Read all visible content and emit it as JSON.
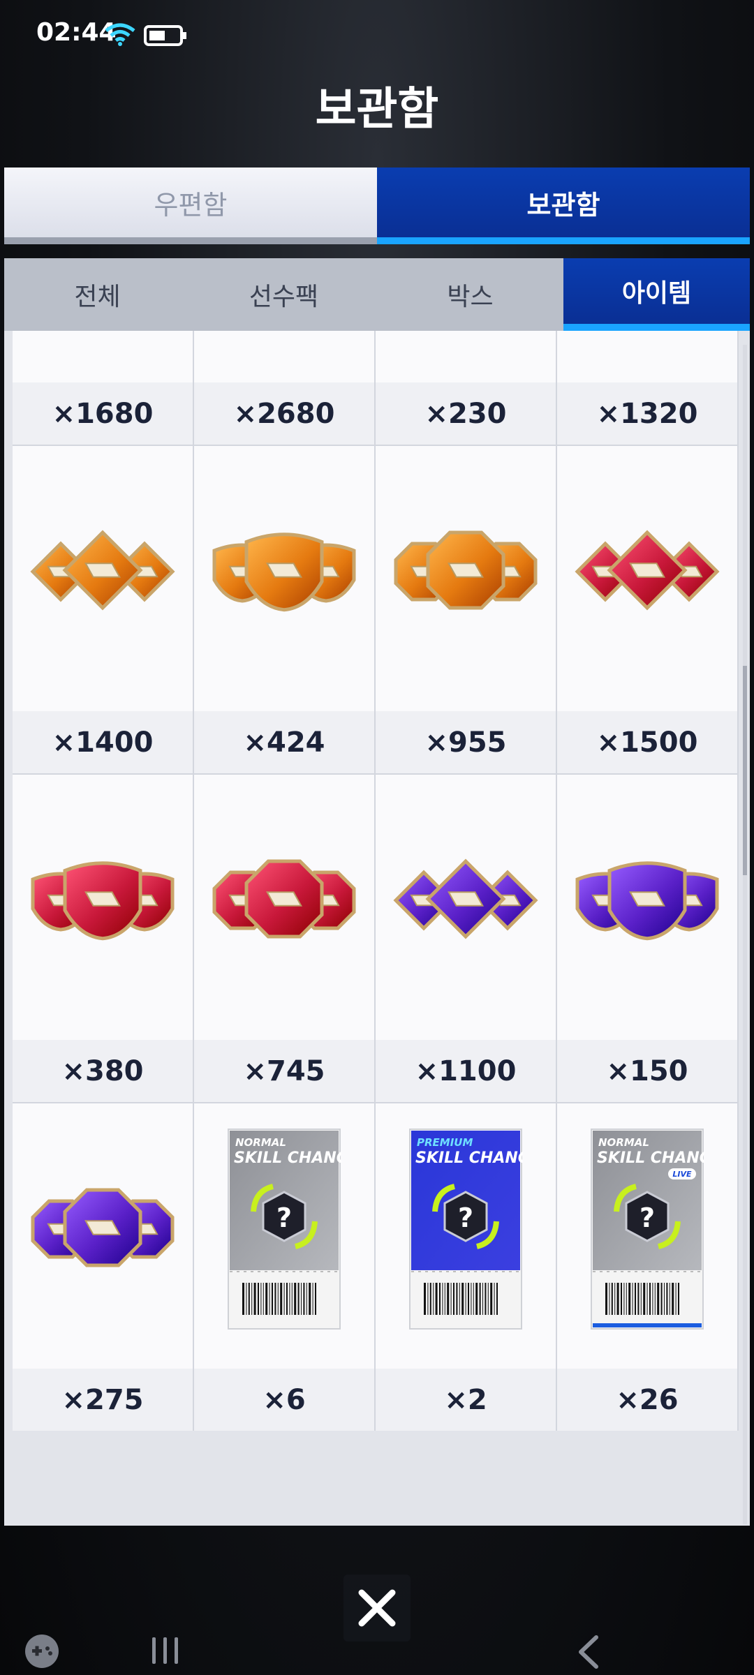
{
  "status": {
    "time": "02:44"
  },
  "page_title": "보관함",
  "main_tabs": [
    {
      "label": "우편함",
      "active": false
    },
    {
      "label": "보관함",
      "active": true
    }
  ],
  "sub_tabs": [
    {
      "label": "전체",
      "active": false
    },
    {
      "label": "선수팩",
      "active": false
    },
    {
      "label": "박스",
      "active": false
    },
    {
      "label": "아이템",
      "active": true
    }
  ],
  "items": [
    {
      "icon": "blue-shield-gem-icon",
      "color": "#2aa0cc",
      "count": "×1680"
    },
    {
      "icon": "lime-diamond-gem-icon",
      "color": "#9cc61c",
      "count": "×2680"
    },
    {
      "icon": "lime-shield-gem-icon",
      "color": "#9cc61c",
      "count": "×230"
    },
    {
      "icon": "lime-octagon-gem-icon",
      "color": "#9cc61c",
      "count": "×1320"
    },
    {
      "icon": "orange-diamond-gem-icon",
      "color": "#e57a10",
      "count": "×1400"
    },
    {
      "icon": "orange-shield-gem-icon",
      "color": "#e57a10",
      "count": "×424"
    },
    {
      "icon": "orange-octagon-gem-icon",
      "color": "#e57a10",
      "count": "×955"
    },
    {
      "icon": "red-diamond-gem-icon",
      "color": "#c8183a",
      "count": "×1500"
    },
    {
      "icon": "red-shield-gem-icon",
      "color": "#c8183a",
      "count": "×380"
    },
    {
      "icon": "red-octagon-gem-icon",
      "color": "#c8183a",
      "count": "×745"
    },
    {
      "icon": "purple-diamond-gem-icon",
      "color": "#5a20c8",
      "count": "×1100"
    },
    {
      "icon": "purple-shield-gem-icon",
      "color": "#5a20c8",
      "count": "×150"
    },
    {
      "icon": "purple-octagon-gem-icon",
      "color": "#5a20c8",
      "count": "×275"
    },
    {
      "icon": "skill-change-ticket-icon",
      "ticket": {
        "tier": "NORMAL",
        "title": "SKILL CHANGE",
        "badge": ""
      },
      "count": "×6"
    },
    {
      "icon": "skill-change-ticket-icon",
      "ticket": {
        "tier": "PREMIUM",
        "title": "SKILL CHANGE",
        "badge": ""
      },
      "count": "×2"
    },
    {
      "icon": "skill-change-ticket-icon",
      "ticket": {
        "tier": "NORMAL",
        "title": "SKILL CHANGE",
        "badge": "LIVE"
      },
      "count": "×26"
    }
  ]
}
